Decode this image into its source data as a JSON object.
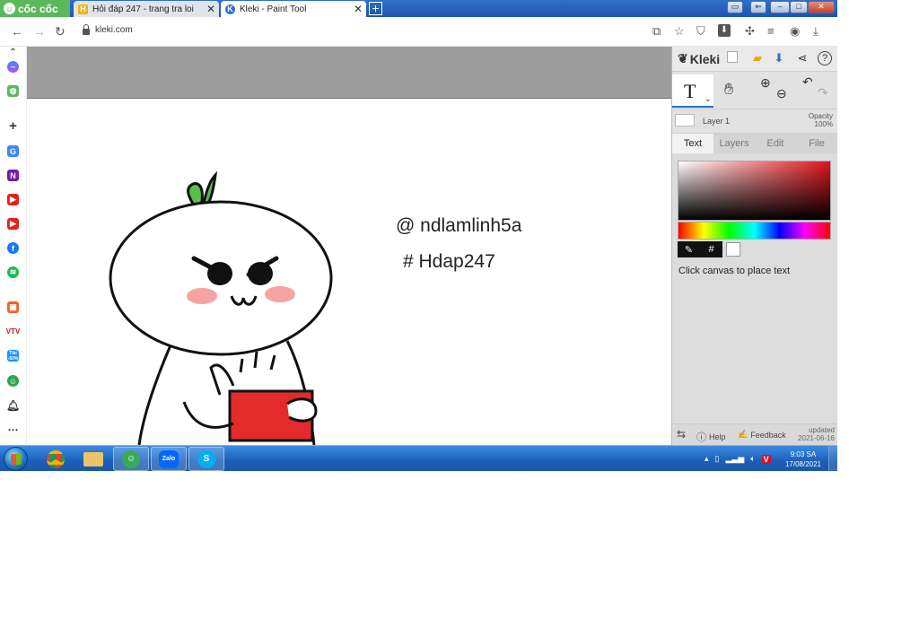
{
  "browser": {
    "brand": "cốc cốc",
    "tabs": [
      {
        "title": "Hỏi đáp 247 - trang tra loi",
        "favicon": "H",
        "active": false
      },
      {
        "title": "Kleki - Paint Tool",
        "favicon": "K",
        "active": true
      }
    ],
    "new_tab": "+",
    "address": "kleki.com"
  },
  "sidebar": {
    "icons": [
      "chevron-up-icon",
      "messenger-icon",
      "game-icon",
      "plus-icon",
      "translate-icon",
      "onenote-icon",
      "youtube-icon",
      "youtube-icon",
      "facebook-icon",
      "spotify-icon",
      "shop-icon",
      "vtv-icon",
      "tiki-icon",
      "coccoc-icon",
      "bell-icon",
      "more-icon"
    ],
    "tiki_label": "Tiki -50%",
    "vtv_label": "VTV"
  },
  "canvas": {
    "text_line_1": "@ ndlamlinh5a",
    "text_line_2": "# Hdap247"
  },
  "kleki": {
    "logo": "Kleki",
    "layer_name": "Layer 1",
    "opacity_label": "Opacity",
    "opacity_value": "100%",
    "tabs": [
      "Text",
      "Layers",
      "Edit",
      "File"
    ],
    "active_tab": "Text",
    "hint": "Click canvas to place text",
    "picker_hash": "#",
    "footer": {
      "help": "Help",
      "feedback": "Feedback",
      "updated_label": "updated",
      "updated_date": "2021-06-16"
    },
    "colors": {
      "selected_hue": "#e0141b",
      "current_color": "#ffffff"
    }
  },
  "taskbar": {
    "apps": [
      "chrome",
      "explorer",
      "coccoc",
      "zalo",
      "skype"
    ],
    "zalo_label": "Zalo",
    "skype_label": "S",
    "time": "9:03 SA",
    "date": "17/08/2021"
  }
}
